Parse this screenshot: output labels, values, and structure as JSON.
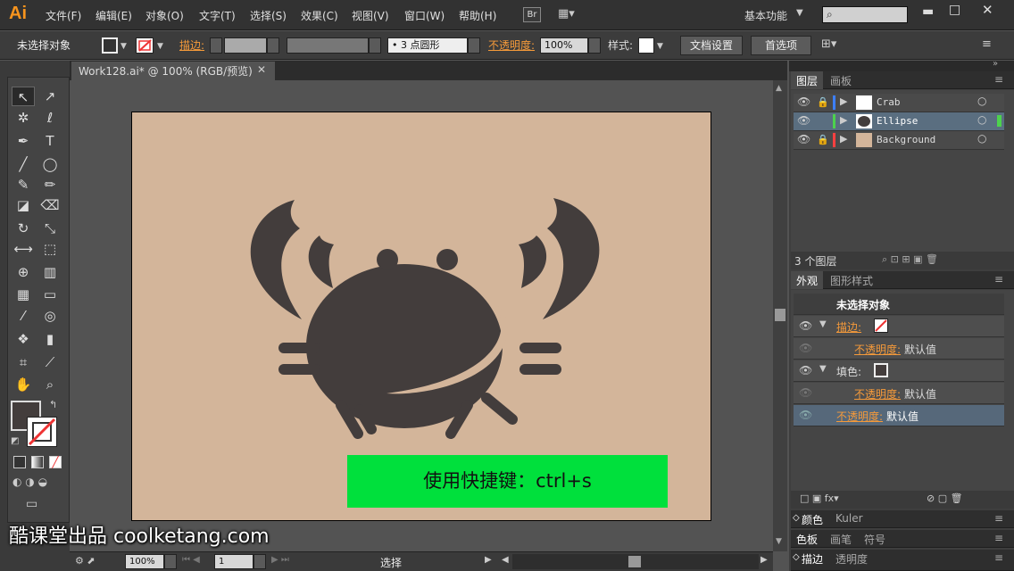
{
  "app": {
    "logo": "Ai"
  },
  "menu": [
    "文件(F)",
    "编辑(E)",
    "对象(O)",
    "文字(T)",
    "选择(S)",
    "效果(C)",
    "视图(V)",
    "窗口(W)",
    "帮助(H)"
  ],
  "bridge_label": "Br",
  "workspace": "基本功能",
  "control": {
    "selection": "未选择对象",
    "stroke_label": "描边:",
    "brush": "3 点圆形",
    "opacity_label": "不透明度:",
    "opacity_value": "100%",
    "style_label": "样式:",
    "doc_setup": "文档设置",
    "prefs": "首选项"
  },
  "document": {
    "tab": "Work128.ai* @ 100% (RGB/预览)"
  },
  "artboard_text": "使用快捷键：ctrl+s",
  "status": {
    "zoom": "100%",
    "page": "1",
    "tool": "选择"
  },
  "layers_panel": {
    "tabs": [
      "图层",
      "画板"
    ],
    "layers": [
      {
        "name": "Crab",
        "color": "#3d7fff",
        "locked": true,
        "selected": false
      },
      {
        "name": "Ellipse",
        "color": "#4dd24d",
        "locked": false,
        "selected": true
      },
      {
        "name": "Background",
        "color": "#ff4040",
        "locked": true,
        "selected": false
      }
    ],
    "count": "3 个图层"
  },
  "appearance_panel": {
    "tabs": [
      "外观",
      "图形样式"
    ],
    "title": "未选择对象",
    "stroke_label": "描边:",
    "opacity_label": "不透明度:",
    "default_value": "默认值",
    "fill_label": "填色:"
  },
  "bottom_panels": {
    "row1": [
      "颜色",
      "Kuler"
    ],
    "row2": [
      "色板",
      "画笔",
      "符号"
    ],
    "row3": [
      "描边",
      "透明度"
    ]
  },
  "watermark": "酷课堂出品 coolketang.com",
  "colors": {
    "crab": "#433d3c",
    "artboard": "#d3b59a",
    "highlight": "#00e03c",
    "accent": "#f59a3a"
  }
}
